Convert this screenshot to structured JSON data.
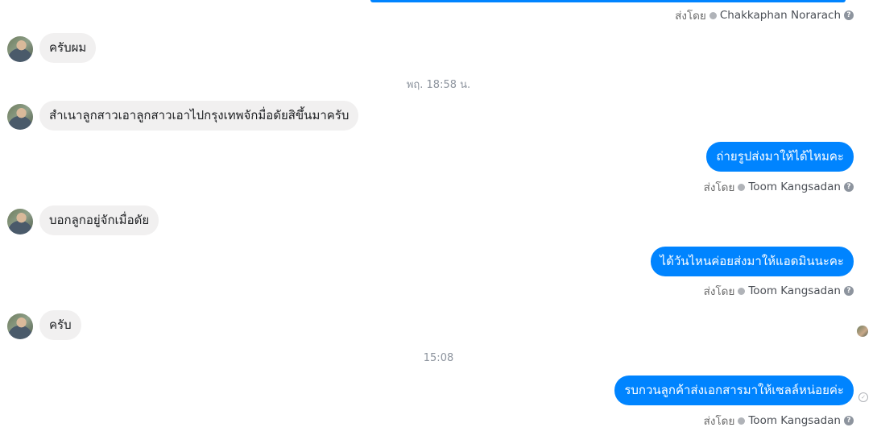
{
  "messages": {
    "top_sender": {
      "prefix": "ส่งโดย",
      "name": "Chakkaphan Norarach"
    },
    "in1": "ครับผม",
    "time1": "พฤ. 18:58 น.",
    "in2": "สำเนาลูกสาวเอาลูกสาวเอาไปกรุงเทพจักมื่อดัยสิขึ้นมาครับ",
    "out1": {
      "text": "ถ่ายรูปส่งมาให้ได้ไหมคะ",
      "prefix": "ส่งโดย",
      "name": "Toom Kangsadan"
    },
    "in3": "บอกลูกอยู่จักเมื่อดัย",
    "out2": {
      "text": "ได้วันไหนค่อยส่งมาให้แอดมินนะคะ",
      "prefix": "ส่งโดย",
      "name": "Toom Kangsadan"
    },
    "in4": "ครับ",
    "time2": "15:08",
    "out3": {
      "text": "รบกวนลูกค้าส่งเอกสารมาให้เซลล์หน่อยค่ะ",
      "prefix": "ส่งโดย",
      "name": "Toom Kangsadan"
    }
  },
  "icons": {
    "check": "verified-check-icon",
    "help": "question-icon",
    "sent": "sent-status-icon"
  },
  "colors": {
    "outgoing": "#0084ff",
    "incoming": "#f1f0f0"
  }
}
